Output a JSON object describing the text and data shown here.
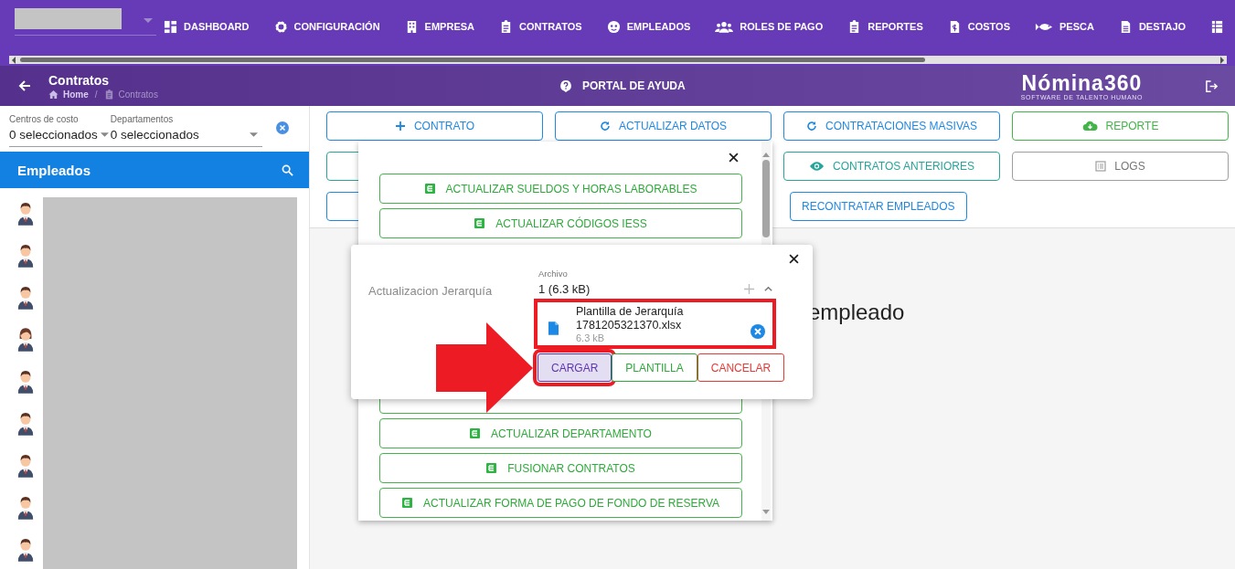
{
  "nav": {
    "items": [
      {
        "label": "DASHBOARD"
      },
      {
        "label": "CONFIGURACIÓN"
      },
      {
        "label": "EMPRESA"
      },
      {
        "label": "CONTRATOS"
      },
      {
        "label": "EMPLEADOS"
      },
      {
        "label": "ROLES DE PAGO"
      },
      {
        "label": "REPORTES"
      },
      {
        "label": "COSTOS"
      },
      {
        "label": "PESCA"
      },
      {
        "label": "DESTAJO"
      }
    ]
  },
  "header": {
    "title": "Contratos",
    "breadcrumb_separator": "/",
    "breadcrumb": [
      {
        "label": "Home",
        "current": false
      },
      {
        "label": "Contratos",
        "current": true
      }
    ],
    "help": "PORTAL DE AYUDA",
    "logo": {
      "name": "Nómina360",
      "tagline": "SOFTWARE DE TALENTO HUMANO"
    }
  },
  "filters": [
    {
      "label": "Centros de costo",
      "value": "0 seleccionados"
    },
    {
      "label": "Departamentos",
      "value": "0 seleccionados"
    }
  ],
  "employees_panel": {
    "title": "Empleados",
    "avatars": [
      {
        "kind": "male"
      },
      {
        "kind": "male"
      },
      {
        "kind": "male"
      },
      {
        "kind": "female"
      },
      {
        "kind": "male"
      },
      {
        "kind": "male"
      },
      {
        "kind": "male"
      },
      {
        "kind": "male"
      },
      {
        "kind": "male"
      }
    ]
  },
  "action_buttons": [
    [
      {
        "kind": "button",
        "label": "CONTRATO",
        "color": "#1e88e5"
      },
      {
        "kind": "button",
        "label": "ACTUALIZAR DATOS",
        "color": "#1e88e5"
      },
      {
        "kind": "button",
        "label": "CONTRATACIONES MASIVAS",
        "color": "#1e88e5"
      },
      {
        "kind": "button",
        "label": "REPORTE",
        "color": "#43b548"
      }
    ],
    [
      {
        "kind": "covered",
        "color": "#26a69a"
      },
      {
        "kind": "button",
        "label": "CONTRATOS ANTERIORES",
        "color": "#26a69a"
      },
      {
        "kind": "button",
        "label": "LOGS",
        "color": "#9e9e9e"
      }
    ],
    [
      {
        "kind": "covered",
        "color": "#1e88e5"
      },
      {
        "kind": "button",
        "label": "RECONTRATAR EMPLEADOS",
        "color": "#1e88e5"
      }
    ]
  ],
  "content": {
    "text": "empleado"
  },
  "actions_menu": {
    "items": [
      {
        "kind": "button",
        "label": "ACTUALIZAR SUELDOS Y HORAS LABORABLES"
      },
      {
        "kind": "button",
        "label": "ACTUALIZAR CÓDIGOS IESS"
      },
      {
        "kind": "covered"
      },
      {
        "kind": "button",
        "label": "ACTUALIZAR DEPARTAMENTO"
      },
      {
        "kind": "button",
        "label": "FUSIONAR CONTRATOS"
      },
      {
        "kind": "button",
        "label": "ACTUALIZAR FORMA DE PAGO DE FONDO DE RESERVA"
      }
    ]
  },
  "upload_dialog": {
    "label": "Actualizacion Jerarquía",
    "field_label": "Archivo",
    "summary": "1 (6.3 kB)",
    "file": {
      "name": "Plantilla de Jerarquía 1781205321370.xlsx",
      "size": "6.3 kB",
      "highlighted": true
    },
    "buttons": [
      {
        "label": "CARGAR",
        "color": "#5e35b1",
        "highlighted": true
      },
      {
        "label": "PLANTILLA",
        "color": "#2eaa3a",
        "highlighted": false
      },
      {
        "label": "CANCELAR",
        "color": "#e53935",
        "highlighted": false
      }
    ]
  }
}
